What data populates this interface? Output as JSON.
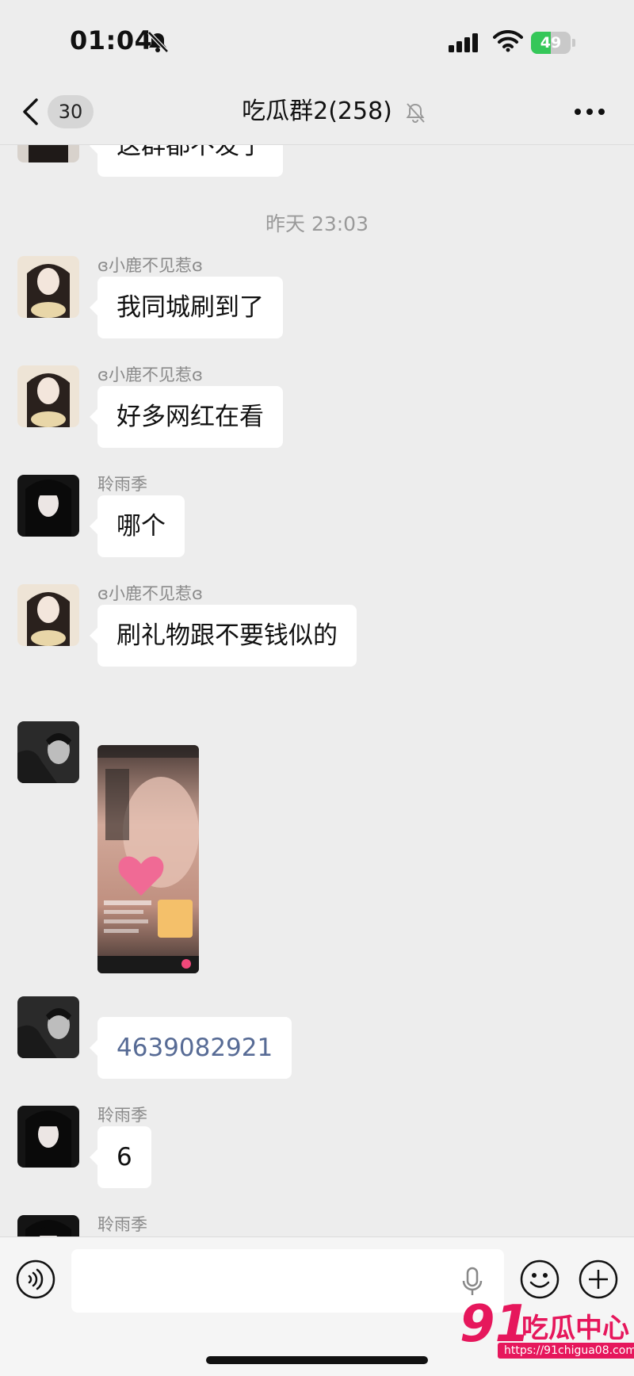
{
  "status_bar": {
    "time": "01:04",
    "battery_level": "49",
    "battery_fraction": 0.49
  },
  "nav": {
    "unread_count": "30",
    "title": "吃瓜群2(258)"
  },
  "messages": [
    {
      "sender": "",
      "text": "这群都不发了"
    },
    {
      "time_label": "昨天 23:03"
    },
    {
      "sender": "ɞ小鹿不见惹ɞ",
      "text": "我同城刷到了"
    },
    {
      "sender": "ɞ小鹿不见惹ɞ",
      "text": "好多网红在看"
    },
    {
      "sender": "聆雨季",
      "text": "哪个"
    },
    {
      "sender": "ɞ小鹿不见惹ɞ",
      "text": "刷礼物跟不要钱似的"
    },
    {
      "sender": "",
      "type": "image"
    },
    {
      "sender": "",
      "text": "4639082921"
    },
    {
      "sender": "聆雨季",
      "text": "6"
    },
    {
      "sender": "聆雨季"
    }
  ],
  "input": {
    "placeholder": ""
  },
  "watermark": {
    "logo_number": "91",
    "logo_text": "吃瓜中心",
    "url": "https://91chigua08.com/"
  },
  "colors": {
    "background": "#ededed",
    "bubble": "#ffffff",
    "link": "#576b95",
    "battery": "#35c759",
    "watermark": "#e6175c"
  },
  "icons": {
    "bell": "bell-off-icon",
    "back": "chevron-left-icon",
    "mute": "bell-off-icon",
    "more": "more-dots-icon",
    "voice": "voice-icon",
    "mic": "mic-icon",
    "emoji": "emoji-icon",
    "plus": "plus-icon"
  }
}
